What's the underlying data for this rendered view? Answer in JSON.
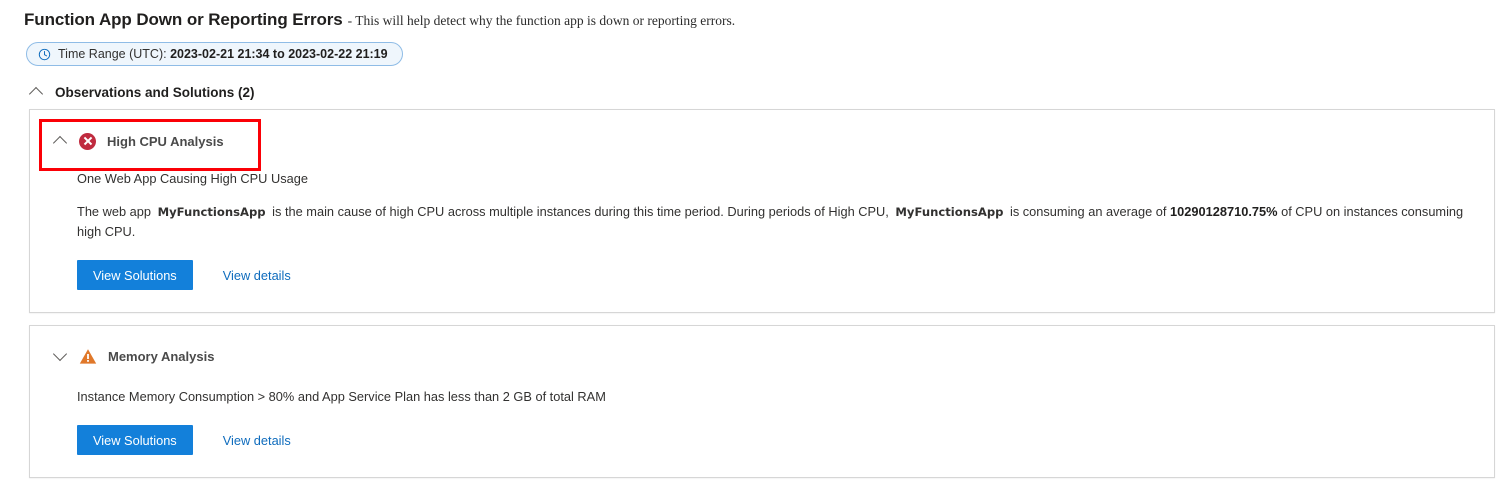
{
  "header": {
    "title": "Function App Down or Reporting Errors",
    "separator": "-",
    "subtitle": "This will help detect why the function app is down or reporting errors."
  },
  "time_range": {
    "icon": "clock-icon",
    "label_prefix": "Time Range (UTC):",
    "value": "2023-02-21 21:34 to 2023-02-22 21:19"
  },
  "observations": {
    "toggle_icon": "chevron-up-icon",
    "title": "Observations and Solutions (2)",
    "count": 2
  },
  "colors": {
    "accent_blue": "#1380da",
    "link_blue": "#0f6cbd",
    "error_red": "#c02b3f",
    "warning_orange": "#e0782a",
    "annotation_red": "#fb0007",
    "pill_border": "#8fbce6",
    "pill_background": "#eff6fc",
    "card_border": "#d6d6d6"
  },
  "insights": [
    {
      "id": "high-cpu-analysis",
      "toggle_icon": "chevron-up-icon",
      "status_icon": "error-icon",
      "status": "error",
      "title": "High CPU Analysis",
      "expanded": true,
      "annotated": true,
      "subhead": "One Web App Causing High CPU Usage",
      "paragraph": {
        "part1": "The web app",
        "app_name_1": "MyFunctionsApp",
        "part2": "is the main cause of high CPU across multiple instances during this time period. During periods of High CPU,",
        "app_name_2": "MyFunctionsApp",
        "part3": "is consuming an average of",
        "percent": "10290128710.75%",
        "part4": "of CPU on instances consuming high CPU."
      },
      "primary_button": "View Solutions",
      "details_link": "View details"
    },
    {
      "id": "memory-analysis",
      "toggle_icon": "chevron-down-icon",
      "status_icon": "warning-icon",
      "status": "warning",
      "title": "Memory Analysis",
      "expanded": false,
      "annotated": false,
      "subhead": "",
      "paragraph": {
        "part1": "Instance Memory Consumption > 80% and App Service Plan has less than 2 GB of total RAM"
      },
      "primary_button": "View Solutions",
      "details_link": "View details"
    }
  ]
}
